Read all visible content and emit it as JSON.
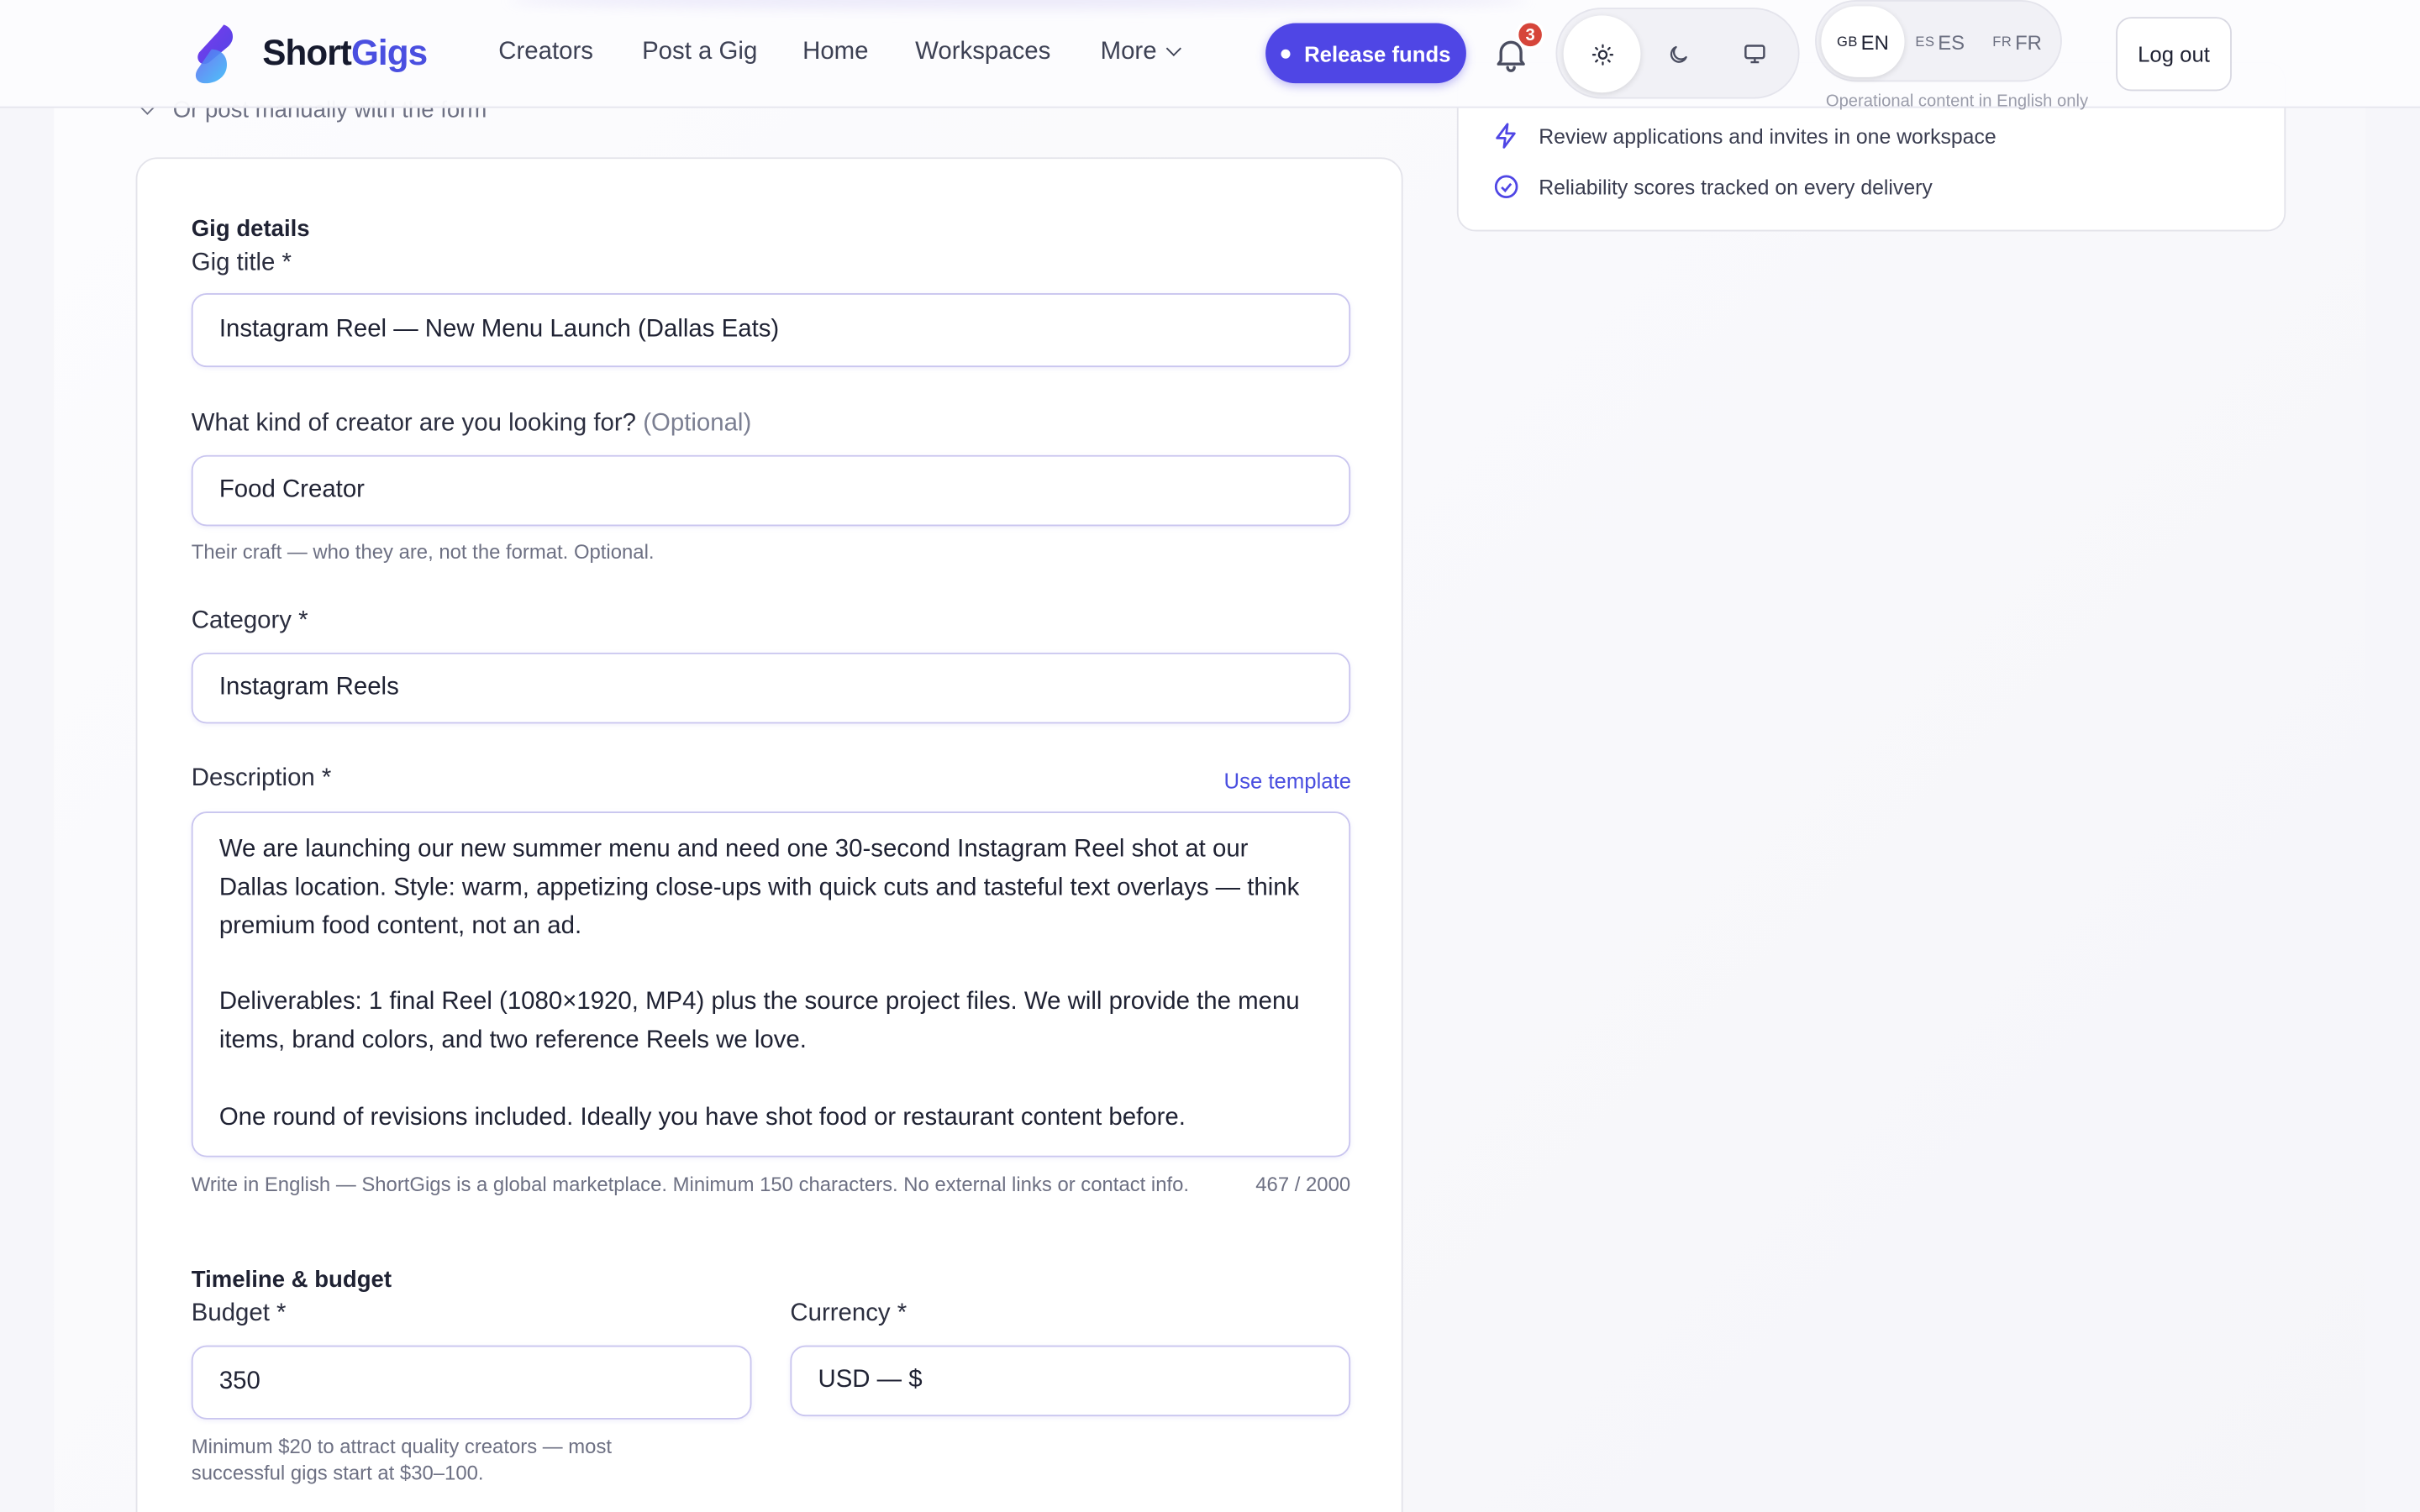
{
  "brand": {
    "name_primary": "Short",
    "name_accent": "Gigs"
  },
  "nav": {
    "links": [
      "Creators",
      "Post a Gig",
      "Home",
      "Workspaces",
      "More"
    ],
    "release_funds": "Release funds",
    "notification_count": "3",
    "languages": [
      {
        "code": "GB",
        "label": "EN",
        "active": true
      },
      {
        "code": "ES",
        "label": "ES",
        "active": false
      },
      {
        "code": "FR",
        "label": "FR",
        "active": false
      }
    ],
    "language_note": "Operational content in English only",
    "logout": "Log out"
  },
  "side_panel": {
    "items": [
      "Review applications and invites in one workspace",
      "Reliability scores tracked on every delivery"
    ]
  },
  "form": {
    "manual_toggle": "Or post manually with the form",
    "gig_details_heading": "Gig details",
    "title_label": "Gig title *",
    "title_value": "Instagram Reel — New Menu Launch (Dallas Eats)",
    "creator_label": "What kind of creator are you looking for?",
    "creator_optional": "(Optional)",
    "creator_value": "Food Creator",
    "creator_help": "Their craft — who they are, not the format. Optional.",
    "category_label": "Category *",
    "category_value": "Instagram Reels",
    "description_label": "Description *",
    "use_template": "Use template",
    "description_value": "We are launching our new summer menu and need one 30-second Instagram Reel shot at our Dallas location. Style: warm, appetizing close-ups with quick cuts and tasteful text overlays — think premium food content, not an ad.\n\nDeliverables: 1 final Reel (1080×1920, MP4) plus the source project files. We will provide the menu items, brand colors, and two reference Reels we love.\n\nOne round of revisions included. Ideally you have shot food or restaurant content before.",
    "description_help": "Write in English — ShortGigs is a global marketplace. Minimum 150 characters. No external links or contact info.",
    "description_count": "467 / 2000",
    "timeline_heading": "Timeline & budget",
    "budget_label": "Budget *",
    "budget_value": "350",
    "budget_help": "Minimum $20 to attract quality creators — most successful gigs start at $30–100.",
    "currency_label": "Currency *",
    "currency_value": "USD — $"
  },
  "colors": {
    "accent": "#4f46e5",
    "badge": "#d6453a"
  }
}
